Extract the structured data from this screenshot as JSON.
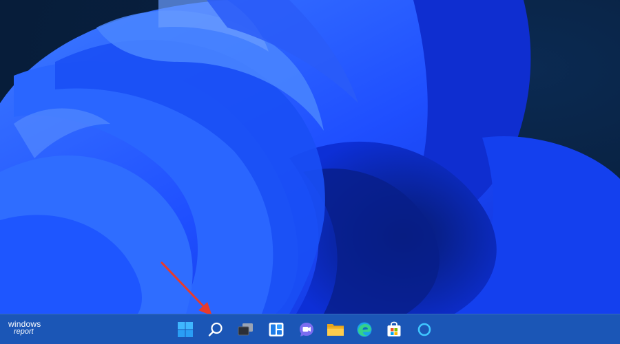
{
  "watermark": {
    "line1": "windows",
    "line2": "report"
  },
  "taskbar": {
    "items": [
      {
        "name": "start",
        "icon": "windows-logo-icon"
      },
      {
        "name": "search",
        "icon": "search-icon"
      },
      {
        "name": "task-view",
        "icon": "task-view-icon"
      },
      {
        "name": "widgets",
        "icon": "widgets-icon"
      },
      {
        "name": "chat",
        "icon": "teams-chat-icon"
      },
      {
        "name": "file-explorer",
        "icon": "folder-icon"
      },
      {
        "name": "edge",
        "icon": "edge-icon"
      },
      {
        "name": "store",
        "icon": "store-icon"
      },
      {
        "name": "cortana",
        "icon": "cortana-icon"
      }
    ]
  },
  "colors": {
    "taskbar": "#1b56b6",
    "arrow": "#e83b2b",
    "wallpaper_blue": "#1f4fff"
  }
}
